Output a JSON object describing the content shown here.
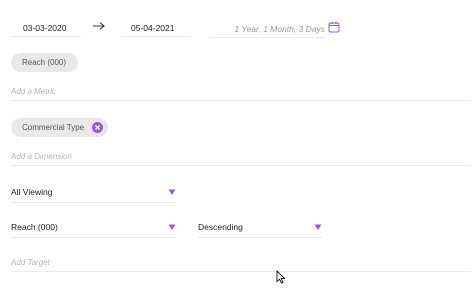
{
  "dates": {
    "start": "03-03-2020",
    "end": "05-04-2021",
    "arrow_icon": "arrow-right-icon",
    "duration": "1 Year, 1 Month, 3 Days",
    "calendar_icon": "calendar-icon"
  },
  "metric": {
    "chip_label": "Reach (000)",
    "add_placeholder": "Add a Metric"
  },
  "dimension": {
    "chip_label": "Commercial Type",
    "remove_icon": "close-circle-icon",
    "add_placeholder": "Add a Dimension"
  },
  "viewing": {
    "selected": "All Viewing"
  },
  "sort": {
    "by_selected": "Reach (000)",
    "order_selected": "Descending"
  },
  "target": {
    "add_placeholder": "Add Target"
  },
  "colors": {
    "accent": "#9b57e0",
    "chip_bg": "#e9e9e9",
    "placeholder": "#b5b5b5"
  }
}
